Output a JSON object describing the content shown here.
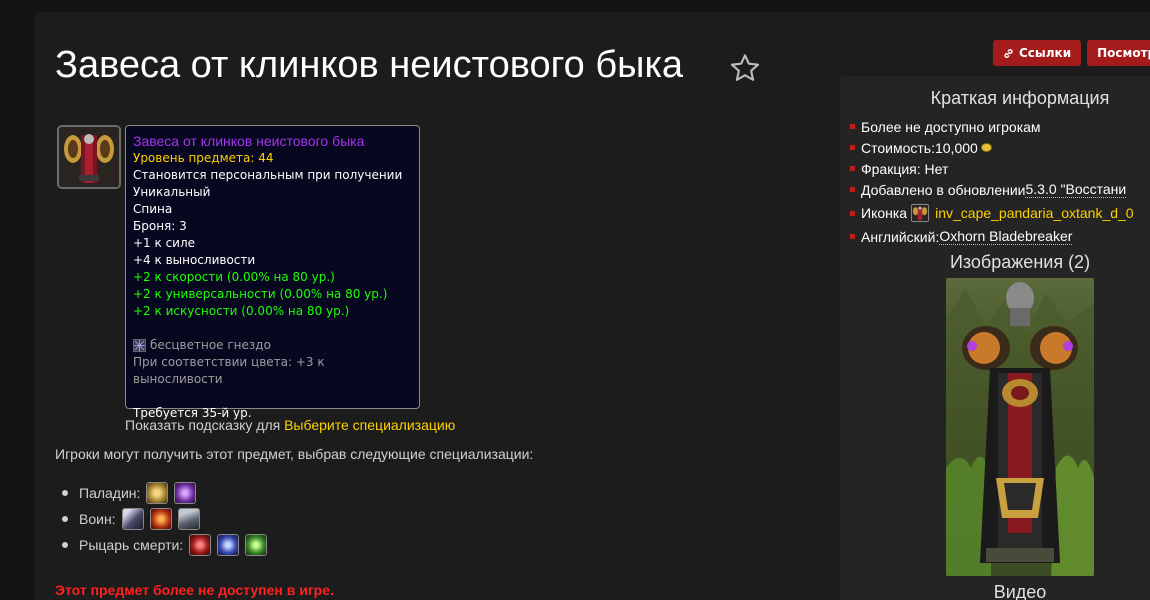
{
  "item": {
    "title": "Завеса от клинков неистового быка",
    "icon": "cloak-icon"
  },
  "buttons": {
    "links": "Ссылки",
    "view": "Посмотрет"
  },
  "tooltip": {
    "name": "Завеса от клинков неистового быка",
    "item_level": "Уровень предмета: 44",
    "bind": "Становится персональным при получении",
    "unique": "Уникальный",
    "slot": "Спина",
    "armor": "Броня: 3",
    "stat_str": "+1 к силе",
    "stat_sta": "+4 к выносливости",
    "green_1": "+2 к скорости (0.00% на 80 ур.)",
    "green_2": "+2 к универсальности (0.00% на 80 ур.)",
    "green_3": "+2 к искусности (0.00% на 80 ур.)",
    "socket": "бесцветное гнездо",
    "socket_bonus": "При соответствии цвета: +3 к выносливости",
    "requires": "Требуется 35-й ур."
  },
  "tip_line": {
    "prefix": "Показать подсказку для",
    "link": "Выберите специализацию"
  },
  "intro": "Игроки могут получить этот предмет, выбрав следующие специализации:",
  "specs": [
    {
      "label": "Паладин:",
      "icons": [
        "paladin-holy-icon",
        "paladin-retribution-icon"
      ]
    },
    {
      "label": "Воин:",
      "icons": [
        "warrior-arms-icon",
        "warrior-fury-icon",
        "warrior-protection-icon"
      ]
    },
    {
      "label": "Рыцарь смерти:",
      "icons": [
        "dk-blood-icon",
        "dk-frost-icon",
        "dk-unholy-icon"
      ]
    }
  ],
  "unavailable": "Этот предмет более не доступен в игре.",
  "sidebar": {
    "title": "Краткая информация",
    "info": {
      "availability": "Более не доступно игрокам",
      "cost_label": "Стоимость: ",
      "cost_value": "10,000",
      "faction": "Фракция: Нет",
      "added_label": "Добавлено в обновлении ",
      "added_value": "5.3.0 \"Восстани",
      "icon_label": "Иконка",
      "icon_name": "inv_cape_pandaria_oxtank_d_0",
      "english_label": "Английский: ",
      "english_value": "Oxhorn Bladebreaker"
    },
    "images_title": "Изображения (2)",
    "video_title": "Видео"
  },
  "colors": {
    "epic": "#a335ee",
    "item_level": "#ffd100",
    "green": "#1eff00",
    "red_button": "#a31b1b",
    "warning": "#ff2020"
  }
}
